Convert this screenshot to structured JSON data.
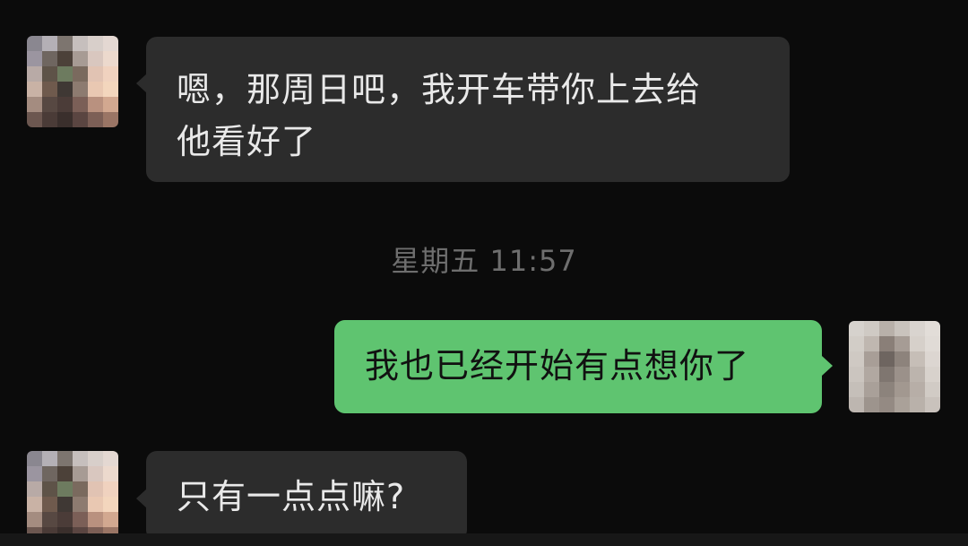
{
  "messages": [
    {
      "side": "in",
      "text_line1": "嗯，那周日吧，我开车带你上去给",
      "text_line2": "他看好了"
    },
    {
      "side": "out",
      "text": "我也已经开始有点想你了"
    },
    {
      "side": "in",
      "text": "只有一点点嘛?"
    }
  ],
  "timestamp": "星期五 11:57",
  "colors": {
    "background": "#0b0b0b",
    "incoming_bubble": "#2c2c2c",
    "outgoing_bubble": "#5fc470",
    "timestamp_text": "#6e6e6e"
  },
  "avatars": {
    "contact": "contact-avatar-blurred",
    "self": "self-avatar-blurred"
  }
}
